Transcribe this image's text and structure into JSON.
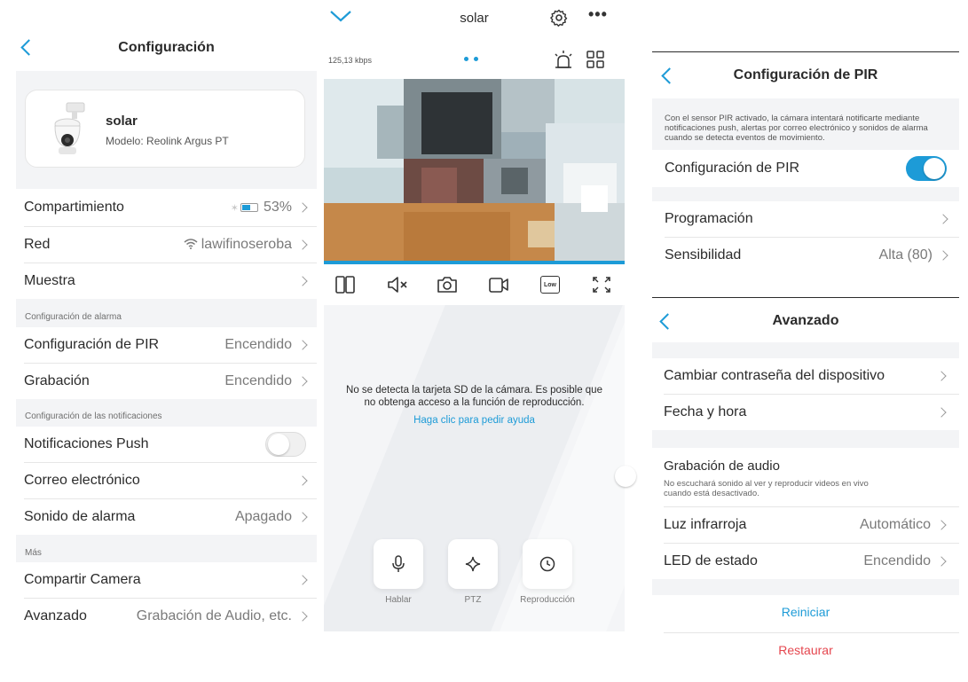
{
  "left": {
    "title": "Configuración",
    "device": {
      "name": "solar",
      "model": "Modelo: Reolink Argus PT"
    },
    "rows": {
      "compartimiento": {
        "label": "Compartimiento",
        "value": "53%"
      },
      "red": {
        "label": "Red",
        "value": "lawifinoseroba"
      },
      "muestra": {
        "label": "Muestra"
      }
    },
    "alarm_section": "Configuración de alarma",
    "pir": {
      "label": "Configuración de PIR",
      "value": "Encendido"
    },
    "grabacion": {
      "label": "Grabación",
      "value": "Encendido"
    },
    "notif_section": "Configuración de las notificaciones",
    "push": {
      "label": "Notificaciones Push",
      "on": false
    },
    "correo": {
      "label": "Correo electrónico"
    },
    "sonido": {
      "label": "Sonido de alarma",
      "value": "Apagado"
    },
    "mas_section": "Más",
    "compartir": {
      "label": "Compartir Camera"
    },
    "avanzado": {
      "label": "Avanzado",
      "value": "Grabación de Audio, etc."
    }
  },
  "middle": {
    "title": "solar",
    "bitrate": "125,13 kbps",
    "sd_message": "No se detecta la tarjeta SD de la cámara. Es posible que no obtenga acceso a la función de reproducción.",
    "help_link": "Haga clic para pedir ayuda",
    "quality_badge": "Low",
    "controls": [
      {
        "label": "Hablar",
        "icon": "mic-icon"
      },
      {
        "label": "PTZ",
        "icon": "ptz-icon"
      },
      {
        "label": "Reproducción",
        "icon": "clock-icon"
      }
    ]
  },
  "pir_panel": {
    "title": "Configuración de PIR",
    "description": "Con el sensor PIR activado, la cámara intentará notificarte mediante notificaciones push, alertas por correo electrónico y sonidos de alarma cuando se detecta eventos de movimiento.",
    "toggle": {
      "label": "Configuración de PIR",
      "on": true
    },
    "programacion": {
      "label": "Programación"
    },
    "sensibilidad": {
      "label": "Sensibilidad",
      "value": "Alta (80)"
    }
  },
  "advanced_panel": {
    "title": "Avanzado",
    "password": {
      "label": "Cambiar contraseña del dispositivo"
    },
    "fecha": {
      "label": "Fecha y hora"
    },
    "audio": {
      "label": "Grabación de audio",
      "note": "No escuchará sonido al ver y reproducir videos en vivo cuando está desactivado.",
      "on": true
    },
    "infrarroja": {
      "label": "Luz infrarroja",
      "value": "Automático"
    },
    "led": {
      "label": "LED de estado",
      "value": "Encendido"
    },
    "reiniciar": "Reiniciar",
    "restaurar": "Restaurar"
  },
  "colors": {
    "accent": "#1d9bd7",
    "danger": "#e5474f",
    "page_gray": "#f3f4f6"
  }
}
